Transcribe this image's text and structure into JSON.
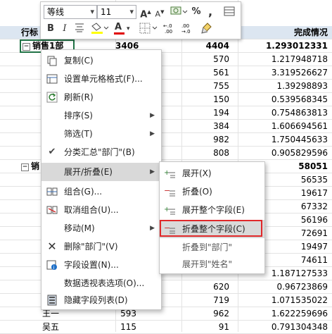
{
  "sheet": {
    "header": {
      "c1": "行标",
      "c4": "完成情况"
    },
    "group1": {
      "label": "销售1部",
      "c2": "3406",
      "c3": "4404",
      "c4": "1.293012331"
    },
    "rows_a": [
      {
        "c3": "570",
        "c4": "1.217948718"
      },
      {
        "c3": "561",
        "c4": "3.319526627"
      },
      {
        "c3": "755",
        "c4": "1.39298893"
      },
      {
        "c3": "150",
        "c4": "0.539568345"
      },
      {
        "c3": "194",
        "c4": "0.754863813"
      },
      {
        "c3": "384",
        "c4": "1.606694561"
      },
      {
        "c3": "982",
        "c4": "1.750445633"
      },
      {
        "c3": "808",
        "c4": "0.905829596"
      }
    ],
    "group2": {
      "label": "销",
      "c4": "58051"
    },
    "rows_b": [
      {
        "c4": "56535"
      },
      {
        "c4": "19617"
      },
      {
        "c4": "67332"
      },
      {
        "c4": "56196"
      },
      {
        "c4": "72691"
      },
      {
        "c4": "19497"
      },
      {
        "c4": "74611"
      },
      {
        "c3": "",
        "c4": "1.187127533"
      },
      {
        "c3": "620",
        "c4": "0.96723869"
      },
      {
        "c3": "719",
        "c4": "1.071535022"
      },
      {
        "c1": "王一",
        "c2": "593",
        "c3": "962",
        "c4": "1.622259696"
      },
      {
        "c1": "吴五",
        "c2": "115",
        "c3": "91",
        "c4": "0.791304348"
      }
    ]
  },
  "mini_toolbar": {
    "font_name": "等线",
    "font_size": "11",
    "grow_font": "A",
    "shrink_font": "A",
    "percent": "%",
    "comma": ",",
    "bold": "B",
    "italic": "I",
    "font_color_letter": "A",
    "fill_color": "#ffff00",
    "font_color": "#e00000",
    "inc_decimal": "←.0 .00",
    "dec_decimal": ".00 →.0"
  },
  "context_menu": {
    "items": [
      {
        "label": "复制(C)",
        "icon": "copy-icon"
      },
      {
        "label": "设置单元格格式(F)...",
        "icon": "format-cells-icon"
      },
      {
        "label": "刷新(R)",
        "icon": "refresh-icon"
      },
      {
        "label": "排序(S)",
        "icon": "",
        "submenu": true
      },
      {
        "label": "筛选(T)",
        "icon": "",
        "submenu": true
      },
      {
        "label": "分类汇总\"部门\"(B)",
        "icon": "check-icon"
      },
      {
        "label": "展开/折叠(E)",
        "icon": "",
        "submenu": true
      },
      {
        "label": "组合(G)...",
        "icon": "group-icon"
      },
      {
        "label": "取消组合(U)...",
        "icon": "ungroup-icon"
      },
      {
        "label": "移动(M)",
        "icon": "",
        "submenu": true
      },
      {
        "label": "删除\"部门\"(V)",
        "icon": "delete-icon"
      },
      {
        "label": "字段设置(N)...",
        "icon": "field-settings-icon"
      },
      {
        "label": "数据透视表选项(O)...",
        "icon": ""
      },
      {
        "label": "隐藏字段列表(D)",
        "icon": "field-list-icon"
      }
    ]
  },
  "submenu": {
    "items": [
      {
        "label": "展开(X)",
        "icon": "expand-icon"
      },
      {
        "label": "折叠(O)",
        "icon": "collapse-icon"
      },
      {
        "label": "展开整个字段(E)",
        "icon": "expand-field-icon"
      },
      {
        "label": "折叠整个字段(C)",
        "icon": "collapse-field-icon"
      },
      {
        "label": "折叠到\"部门\"",
        "icon": ""
      },
      {
        "label": "展开到\"姓名\"",
        "icon": ""
      }
    ]
  }
}
